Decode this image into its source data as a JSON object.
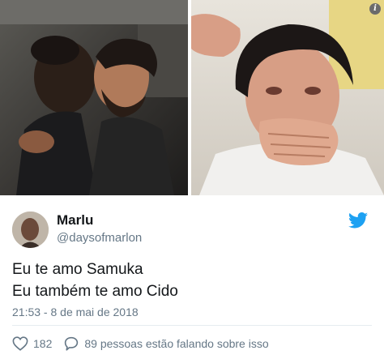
{
  "photos": {
    "left": {
      "alt": ""
    },
    "right": {
      "alt": ""
    }
  },
  "tweet": {
    "display_name": "Marlu",
    "handle": "@daysofmarlon",
    "lines": [
      "Eu te amo Samuka",
      "Eu também te amo Cido"
    ],
    "timestamp": "21:53 - 8 de mai de 2018",
    "likes": "182",
    "replies_text": "89 pessoas estão falando sobre isso"
  },
  "icons": {
    "info": "info-icon",
    "twitter": "twitter-bird-icon",
    "like": "heart-icon",
    "reply": "speech-bubble-icon"
  },
  "colors": {
    "twitter_blue": "#1da1f2",
    "muted": "#657786",
    "text": "#14171a"
  }
}
